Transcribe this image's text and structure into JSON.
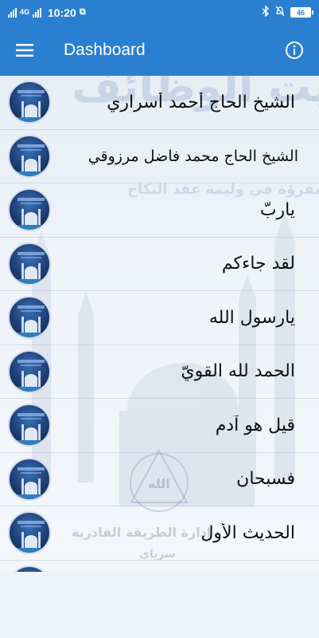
{
  "status_bar": {
    "network": "4G",
    "time": "10:20",
    "battery": "46",
    "icons": [
      "signal-icon",
      "wifi-signal-icon",
      "screenshot-icon",
      "bluetooth-icon",
      "mute-icon",
      "battery-icon"
    ]
  },
  "app_bar": {
    "title": "Dashboard",
    "menu_icon": "hamburger-menu-icon",
    "info_icon": "info-icon"
  },
  "colors": {
    "primary": "#2a7fd0",
    "background": "#eef3f8",
    "text": "#101010"
  },
  "background_art": {
    "line1": "بيت الوظائف",
    "line2": "والمقرؤة في وليمة عقد النكاح",
    "logo_text": "الله",
    "footer1": "ادارة الطريقة القادرية",
    "footer2": "سرياي"
  },
  "items": [
    {
      "label": "الشيخ الحاج أحمد أسراري"
    },
    {
      "label": "الشيخ الحاج محمد فاضل مرزوقي"
    },
    {
      "label": "ياربّ"
    },
    {
      "label": "لقد جاءكم"
    },
    {
      "label": "يارسول الله"
    },
    {
      "label": "الحمد لله القويّ"
    },
    {
      "label": "قيل هو آدم"
    },
    {
      "label": "فسبحان"
    },
    {
      "label": "الحديث الأول"
    },
    {
      "label": ""
    }
  ]
}
